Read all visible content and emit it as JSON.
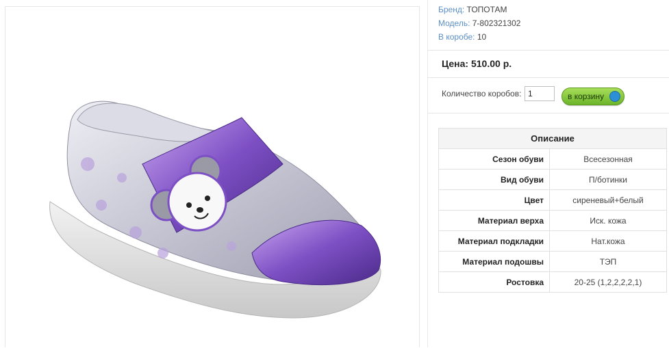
{
  "product": {
    "brand_label": "Бренд:",
    "brand": "ТОПОТАМ",
    "model_label": "Модель:",
    "model": "7-802321302",
    "box_label": "В коробе:",
    "box_count": "10",
    "price": "Цена: 510.00 р.",
    "image_name": "shoe-photo"
  },
  "order": {
    "quantity_label": "Количество коробов:",
    "quantity_value": "1",
    "cart_button": "в корзину",
    "cart_icon": "cart-icon"
  },
  "description": {
    "header": "Описание",
    "rows": [
      {
        "label": "Сезон обуви",
        "value": "Всесезонная"
      },
      {
        "label": "Вид обуви",
        "value": "П/ботинки"
      },
      {
        "label": "Цвет",
        "value": "сиреневый+белый"
      },
      {
        "label": "Материал верха",
        "value": "Иск. кожа"
      },
      {
        "label": "Материал подкладки",
        "value": "Нат.кожа"
      },
      {
        "label": "Материал подошвы",
        "value": "ТЭП"
      },
      {
        "label": "Ростовка",
        "value": "20-25 (1,2,2,2,2,1)"
      }
    ]
  },
  "colors": {
    "accent_link": "#5b8fc7",
    "button_green": "#6cb52b",
    "shoe_purple": "#8a5cc8",
    "shoe_silver": "#c9c9d6"
  }
}
